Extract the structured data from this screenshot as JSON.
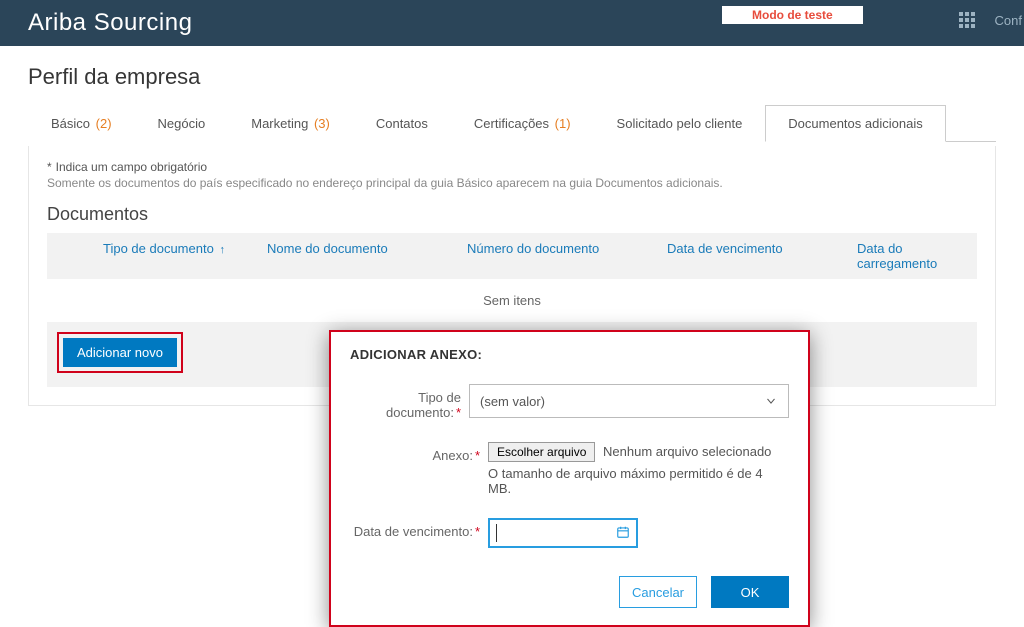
{
  "header": {
    "brand": "Ariba Sourcing",
    "test_mode": "Modo de teste",
    "config_link": "Conf"
  },
  "page": {
    "title": "Perfil da empresa",
    "required_note": "Indica um campo obrigatório",
    "sub_note": "Somente os documentos do país especificado no endereço principal da guia Básico aparecem na guia Documentos adicionais.",
    "section_head": "Documentos"
  },
  "tabs": {
    "basico": {
      "label": "Básico",
      "count": "(2)"
    },
    "negocio": {
      "label": "Negócio"
    },
    "marketing": {
      "label": "Marketing",
      "count": "(3)"
    },
    "contatos": {
      "label": "Contatos"
    },
    "certificacoes": {
      "label": "Certificações",
      "count": "(1)"
    },
    "solicitado": {
      "label": "Solicitado pelo cliente"
    },
    "documentos": {
      "label": "Documentos adicionais"
    }
  },
  "table": {
    "cols": {
      "tipo": "Tipo de documento",
      "nome": "Nome do documento",
      "numero": "Número do documento",
      "vencimento": "Data de vencimento",
      "carregamento": "Data do carregamento"
    },
    "empty": "Sem itens",
    "add_label": "Adicionar novo"
  },
  "modal": {
    "title": "ADICIONAR ANEXO:",
    "tipo_label": "Tipo de documento:",
    "tipo_placeholder": "(sem valor)",
    "anexo_label": "Anexo:",
    "choose_file": "Escolher arquivo",
    "file_status": "Nenhum arquivo selecionado",
    "file_hint": "O tamanho de arquivo máximo permitido é de 4 MB.",
    "data_label": "Data de vencimento:",
    "cancel": "Cancelar",
    "ok": "OK"
  }
}
